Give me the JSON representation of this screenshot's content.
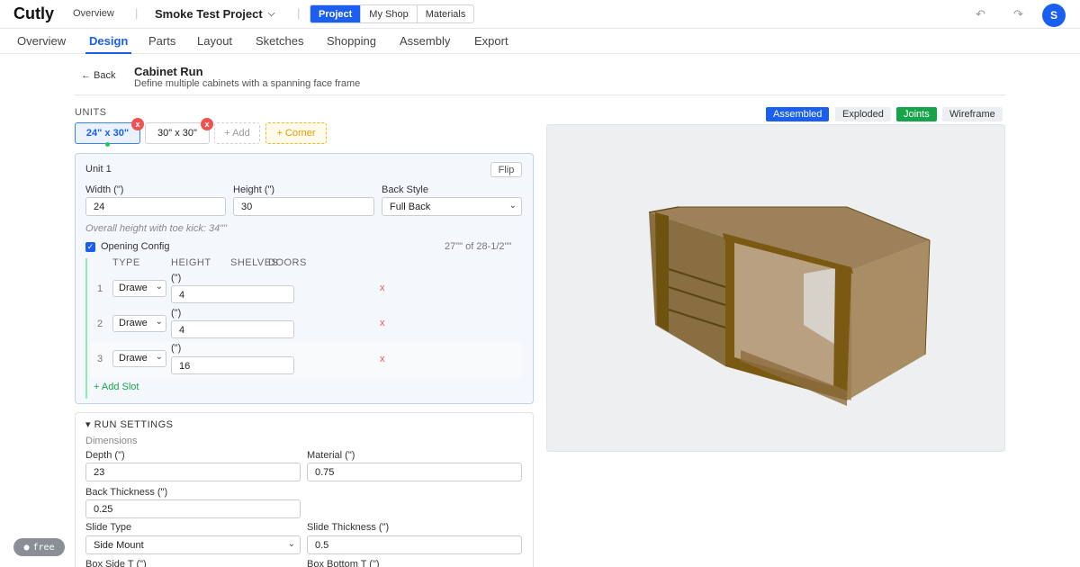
{
  "app": {
    "logo": "Cutly",
    "overview_link": "Overview",
    "project_name": "Smoke Test Project",
    "segments": [
      "Project",
      "My Shop",
      "Materials"
    ],
    "active_segment": "Project",
    "avatar_initial": "S"
  },
  "tabs": [
    "Overview",
    "Design",
    "Parts",
    "Layout",
    "Sketches",
    "Shopping",
    "Assembly",
    "Export"
  ],
  "active_tab": "Design",
  "header": {
    "back": "← Back",
    "title": "Cabinet Run",
    "subtitle": "Define multiple cabinets with a spanning face frame"
  },
  "units": {
    "label": "UNITS",
    "chips": [
      "24\" x 30\"",
      "30\" x 30\""
    ],
    "remove_glyph": "x",
    "add_label": "+ Add",
    "corner_label": "+ Corner"
  },
  "unit": {
    "title": "Unit 1",
    "flip_label": "Flip",
    "width_label": "Width (\")",
    "width_value": "24",
    "height_label": "Height (\")",
    "height_value": "30",
    "back_style_label": "Back Style",
    "back_style_value": "Full Back",
    "overall_height_hint": "Overall height with toe kick: 34\"\"",
    "opening_config_label": "Opening Config",
    "opening_count": "27\"\" of 28-1/2\"\"",
    "col_type": "TYPE",
    "col_height": "HEIGHT",
    "col_shelves": "SHELVES",
    "col_doors": "DOORS",
    "slots": [
      {
        "num": "1",
        "type": "Drawe",
        "unit": "(\")",
        "height": "4",
        "remove": "x"
      },
      {
        "num": "2",
        "type": "Drawe",
        "unit": "(\")",
        "height": "4",
        "remove": "x"
      },
      {
        "num": "3",
        "type": "Drawe",
        "unit": "(\")",
        "height": "16",
        "remove": "x"
      }
    ],
    "add_slot": "+ Add Slot"
  },
  "run_settings": {
    "title": "▾ RUN SETTINGS",
    "dimensions_label": "Dimensions",
    "depth_label": "Depth (\")",
    "depth_value": "23",
    "material_label": "Material (\")",
    "material_value": "0.75",
    "back_thickness_label": "Back Thickness (\")",
    "back_thickness_value": "0.25",
    "slide_type_label": "Slide Type",
    "slide_type_value": "Side Mount",
    "slide_thickness_label": "Slide Thickness (\")",
    "slide_thickness_value": "0.5",
    "box_side_label": "Box Side T (\")",
    "box_bottom_label": "Box Bottom T (\")"
  },
  "view_modes": [
    "Assembled",
    "Exploded",
    "Joints",
    "Wireframe"
  ],
  "active_view_mode": "Assembled",
  "active_overlay": "Joints",
  "badge": "free",
  "colors": {
    "accent": "#1a5ff0",
    "success": "#16a34a",
    "danger": "#f05252",
    "wood": "#9b7a4a",
    "face_frame": "#7a5a12"
  }
}
